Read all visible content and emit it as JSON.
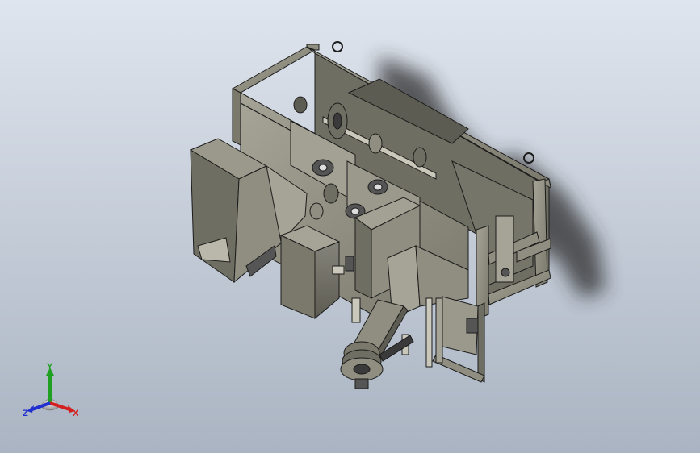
{
  "viewport": {
    "background_top": "#dfe5ee",
    "background_bottom": "#aab4c2"
  },
  "model": {
    "body_color": "#8f8e80",
    "body_dark": "#6f6e62",
    "shadow_color": "#2a2a2a",
    "edge_color": "#1c1c1c"
  },
  "triad": {
    "x_label": "X",
    "y_label": "Y",
    "z_label": "Z",
    "x_color": "#d42020",
    "y_color": "#20a020",
    "z_color": "#2030d0"
  }
}
